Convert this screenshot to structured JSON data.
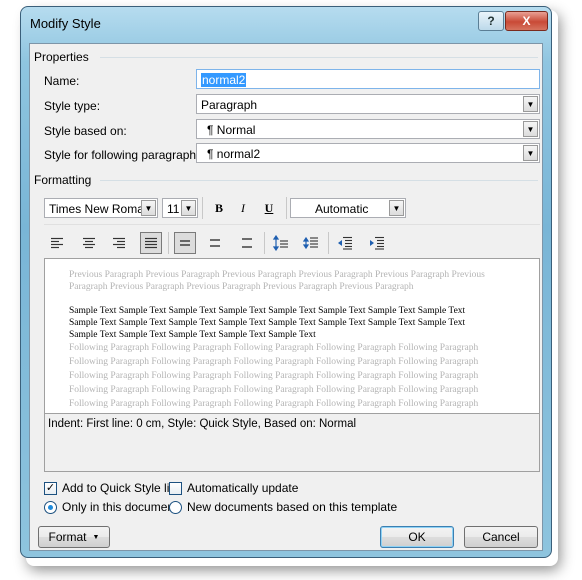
{
  "window": {
    "title": "Modify Style",
    "help_glyph": "?",
    "close_glyph": "X"
  },
  "properties": {
    "section_label": "Properties",
    "name_label": "Name:",
    "name_value": "normal2",
    "style_type_label": "Style type:",
    "style_type_value": "Paragraph",
    "based_on_label": "Style based on:",
    "based_on_value": "¶ Normal",
    "following_label": "Style for following paragraph:",
    "following_value": "¶ normal2"
  },
  "formatting": {
    "section_label": "Formatting",
    "font_name": "Times New Roman",
    "font_size": "11",
    "bold": "B",
    "italic": "I",
    "underline": "U",
    "color_value": "Automatic"
  },
  "preview": {
    "previous_lines": [
      "Previous Paragraph Previous Paragraph Previous Paragraph Previous Paragraph Previous Paragraph Previous",
      "Paragraph Previous Paragraph Previous Paragraph Previous Paragraph Previous Paragraph"
    ],
    "sample_lines": [
      "Sample Text Sample Text Sample Text Sample Text Sample Text Sample Text Sample Text Sample Text",
      "Sample Text Sample Text Sample Text Sample Text Sample Text Sample Text Sample Text Sample Text",
      "Sample Text Sample Text Sample Text Sample Text Sample Text"
    ],
    "following_lines": [
      "Following Paragraph Following Paragraph Following Paragraph Following Paragraph Following Paragraph",
      "Following Paragraph Following Paragraph Following Paragraph Following Paragraph Following Paragraph",
      "Following Paragraph Following Paragraph Following Paragraph Following Paragraph Following Paragraph",
      "Following Paragraph Following Paragraph Following Paragraph Following Paragraph Following Paragraph",
      "Following Paragraph Following Paragraph Following Paragraph Following Paragraph Following Paragraph"
    ]
  },
  "description": "Indent: First line:  0 cm, Style: Quick Style, Based on: Normal",
  "options": {
    "add_quick_style": "Add to Quick Style list",
    "add_quick_style_checked": true,
    "auto_update": "Automatically update",
    "auto_update_checked": false,
    "only_this_doc": "Only in this document",
    "new_docs": "New documents based on this template",
    "selected_scope": "only_this_doc"
  },
  "buttons": {
    "format": "Format",
    "ok": "OK",
    "cancel": "Cancel"
  }
}
